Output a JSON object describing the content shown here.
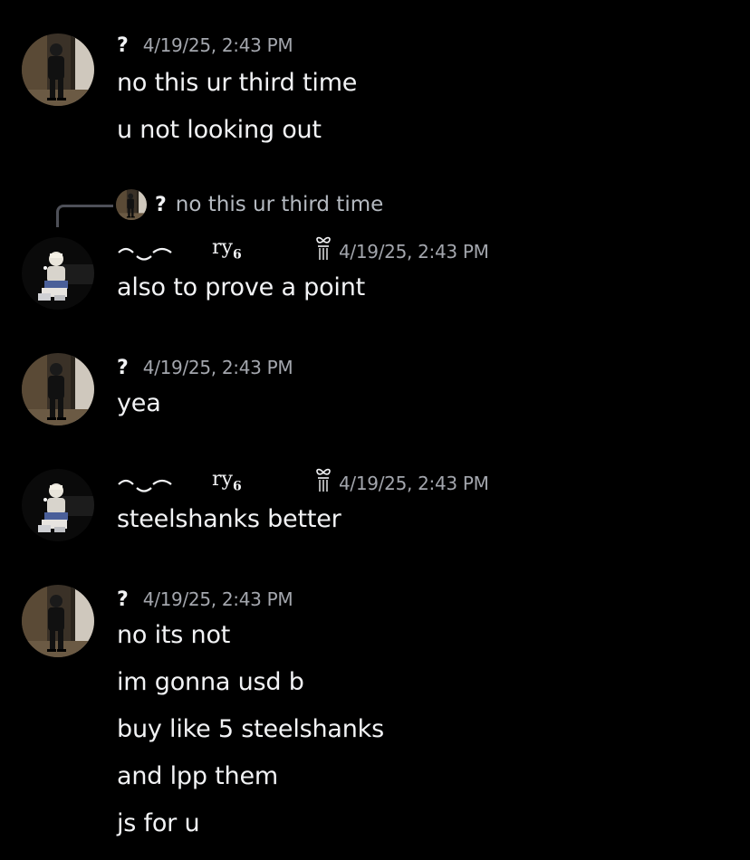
{
  "messages": [
    {
      "author": "?",
      "timestamp": "4/19/25, 2:43 PM",
      "lines": [
        "no this ur third time",
        "u not looking out"
      ]
    },
    {
      "author": "ry6",
      "timestamp": "4/19/25, 2:43 PM",
      "reply": {
        "author": "?",
        "text": "no this ur third time"
      },
      "lines": [
        "also to prove a point"
      ]
    },
    {
      "author": "?",
      "timestamp": "4/19/25, 2:43 PM",
      "lines": [
        "yea"
      ]
    },
    {
      "author": "ry6",
      "timestamp": "4/19/25, 2:43 PM",
      "lines": [
        "steelshanks better"
      ]
    },
    {
      "author": "?",
      "timestamp": "4/19/25, 2:43 PM",
      "lines": [
        "no its not",
        "im gonna usd b",
        "buy like 5 steelshanks",
        "and lpp them",
        "js for u"
      ]
    }
  ],
  "fancy_name": {
    "main": "ry",
    "sub": "6"
  },
  "icons": {
    "avatar_question_user": "person-avatar-icon",
    "avatar_ry6_user": "person-avatar-icon",
    "bow_decoration": "bow-icon"
  },
  "colors": {
    "background": "#000000",
    "text": "#f2f3f5",
    "timestamp": "#a3a6ad",
    "reply_text": "#b5bac1",
    "reply_line": "#4e5058"
  }
}
